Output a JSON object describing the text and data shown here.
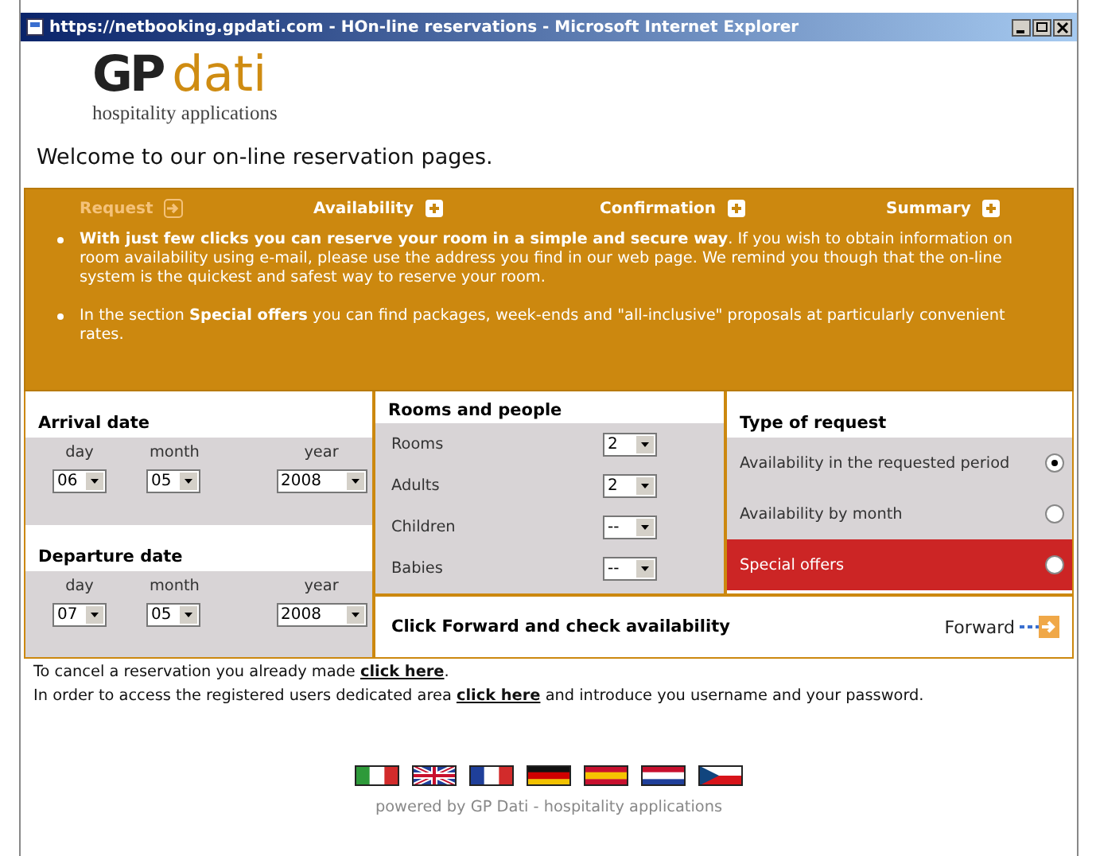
{
  "window": {
    "title": "https://netbooking.gpdati.com - HOn-line reservations - Microsoft Internet Explorer"
  },
  "logo": {
    "mark": "GP",
    "word": "dati",
    "tagline": "hospitality applications"
  },
  "heading": "Welcome to our on-line reservation pages.",
  "steps": [
    {
      "label": "Request",
      "selected": true
    },
    {
      "label": "Availability",
      "selected": false
    },
    {
      "label": "Confirmation",
      "selected": false
    },
    {
      "label": "Summary",
      "selected": false
    }
  ],
  "intro": [
    "**With just few clicks you can reserve your room in a simple and secure way**. If you wish to obtain information on room availability using e-mail, please use the address you find in our web page. We remind you though that the on-line system is the quickest and safest way to reserve your room.",
    "In the section **Special offers** you can find packages, week-ends and \"all-inclusive\" proposals at particularly convenient rates."
  ],
  "dates": [
    {
      "title": "Arrival date",
      "fields": [
        {
          "label": "day",
          "value": "06"
        },
        {
          "label": "month",
          "value": "05"
        },
        {
          "label": "year",
          "value": "2008"
        }
      ]
    },
    {
      "title": "Departure date",
      "fields": [
        {
          "label": "day",
          "value": "07"
        },
        {
          "label": "month",
          "value": "05"
        },
        {
          "label": "year",
          "value": "2008"
        }
      ]
    }
  ],
  "rooms": {
    "title": "Rooms and people",
    "rows": [
      {
        "label": "Rooms",
        "value": "2"
      },
      {
        "label": "Adults",
        "value": "2"
      },
      {
        "label": "Children",
        "value": "--"
      },
      {
        "label": "Babies",
        "value": "--"
      }
    ]
  },
  "request_type": {
    "title": "Type of request",
    "options": [
      {
        "label": "Availability in the requested period",
        "selected": true,
        "highlighted": false
      },
      {
        "label": "Availability by month",
        "selected": false,
        "highlighted": false
      },
      {
        "label": "Special offers",
        "selected": false,
        "highlighted": true
      }
    ]
  },
  "forward": {
    "text": "Click Forward and check availability",
    "button": "Forward"
  },
  "links": [
    {
      "before": "To cancel a reservation you already made ",
      "link": "click here",
      "after": "."
    },
    {
      "before": "In order to access the registered users dedicated area ",
      "link": "click here",
      "after": " and introduce you username and your password."
    }
  ],
  "flags": [
    {
      "kind": "italy"
    },
    {
      "kind": "uk"
    },
    {
      "kind": "france"
    },
    {
      "kind": "germany"
    },
    {
      "kind": "spain"
    },
    {
      "kind": "netherlands"
    },
    {
      "kind": "czech"
    }
  ],
  "footer": "powered by GP Dati - hospitality applications"
}
